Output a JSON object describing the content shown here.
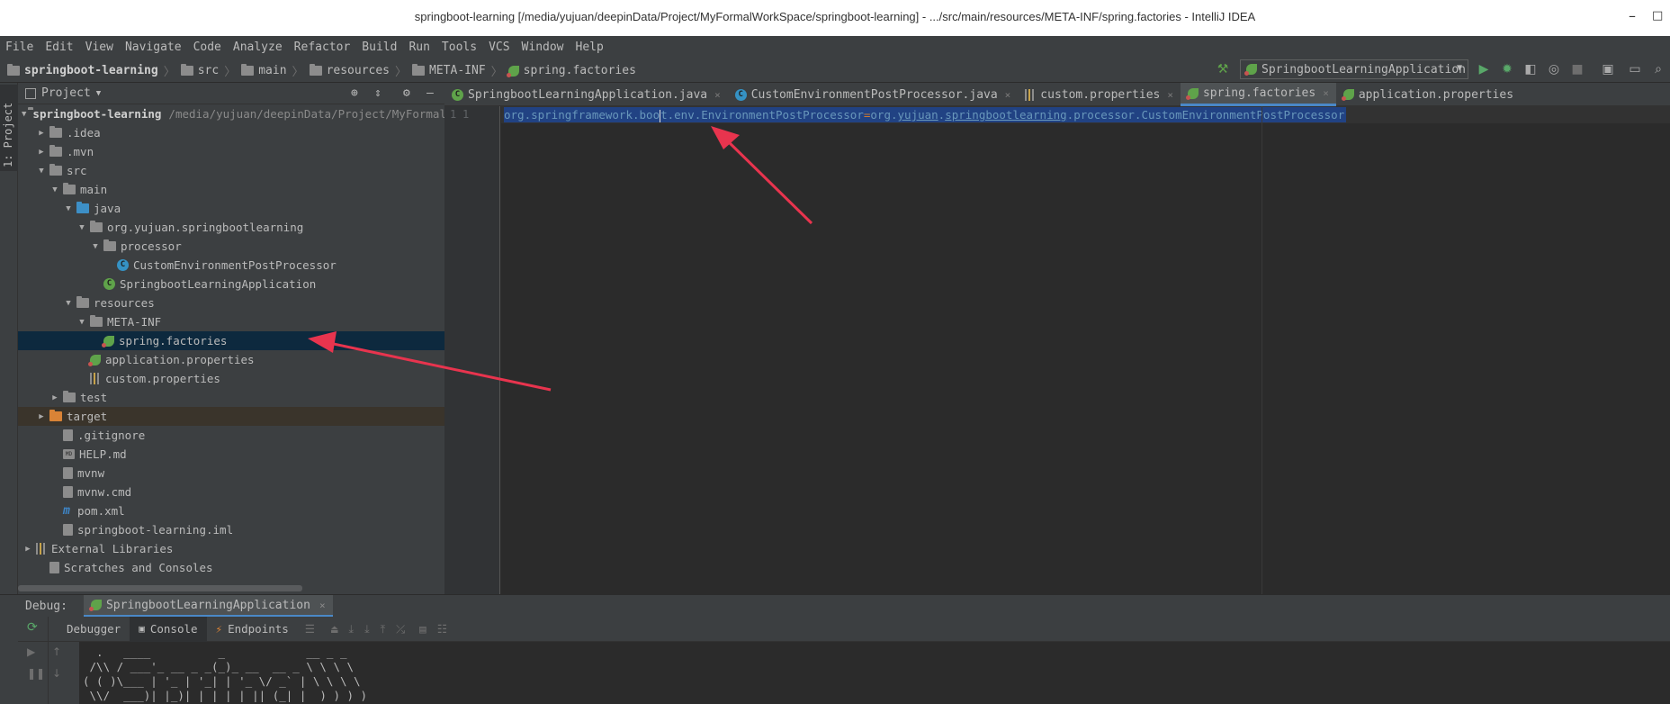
{
  "window": {
    "title": "springboot-learning [/media/yujuan/deepinData/Project/MyFormalWorkSpace/springboot-learning] - .../src/main/resources/META-INF/spring.factories - IntelliJ IDEA",
    "minimize": "–",
    "maximize": "□"
  },
  "menu": [
    "File",
    "Edit",
    "View",
    "Navigate",
    "Code",
    "Analyze",
    "Refactor",
    "Build",
    "Run",
    "Tools",
    "VCS",
    "Window",
    "Help"
  ],
  "breadcrumb": [
    "springboot-learning",
    "src",
    "main",
    "resources",
    "META-INF",
    "spring.factories"
  ],
  "run_config": {
    "label": "SpringbootLearningApplication"
  },
  "project_panel": {
    "title": "Project",
    "side_tab": "1: Project",
    "tree": [
      {
        "label": "springboot-learning",
        "path": "/media/yujuan/deepinData/Project/MyFormalW",
        "indent": 0,
        "arrow": "▼",
        "icon": "folder",
        "bold": true
      },
      {
        "label": ".idea",
        "indent": 1,
        "arrow": "▶",
        "icon": "folder"
      },
      {
        "label": ".mvn",
        "indent": 1,
        "arrow": "▶",
        "icon": "folder"
      },
      {
        "label": "src",
        "indent": 1,
        "arrow": "▼",
        "icon": "folder"
      },
      {
        "label": "main",
        "indent": 2,
        "arrow": "▼",
        "icon": "folder"
      },
      {
        "label": "java",
        "indent": 3,
        "arrow": "▼",
        "icon": "folder-blue"
      },
      {
        "label": "org.yujuan.springbootlearning",
        "indent": 4,
        "arrow": "▼",
        "icon": "folder"
      },
      {
        "label": "processor",
        "indent": 5,
        "arrow": "▼",
        "icon": "folder"
      },
      {
        "label": "CustomEnvironmentPostProcessor",
        "indent": 6,
        "arrow": "",
        "icon": "class"
      },
      {
        "label": "SpringbootLearningApplication",
        "indent": 5,
        "arrow": "",
        "icon": "spring-class"
      },
      {
        "label": "resources",
        "indent": 3,
        "arrow": "▼",
        "icon": "folder"
      },
      {
        "label": "META-INF",
        "indent": 4,
        "arrow": "▼",
        "icon": "folder"
      },
      {
        "label": "spring.factories",
        "indent": 5,
        "arrow": "",
        "icon": "leaf",
        "selected": true
      },
      {
        "label": "application.properties",
        "indent": 4,
        "arrow": "",
        "icon": "leaf"
      },
      {
        "label": "custom.properties",
        "indent": 4,
        "arrow": "",
        "icon": "prop"
      },
      {
        "label": "test",
        "indent": 2,
        "arrow": "▶",
        "icon": "folder"
      },
      {
        "label": "target",
        "indent": 1,
        "arrow": "▶",
        "icon": "folder-orange",
        "excluded": true
      },
      {
        "label": ".gitignore",
        "indent": 2,
        "arrow": "",
        "icon": "file"
      },
      {
        "label": "HELP.md",
        "indent": 2,
        "arrow": "",
        "icon": "md"
      },
      {
        "label": "mvnw",
        "indent": 2,
        "arrow": "",
        "icon": "file"
      },
      {
        "label": "mvnw.cmd",
        "indent": 2,
        "arrow": "",
        "icon": "file"
      },
      {
        "label": "pom.xml",
        "indent": 2,
        "arrow": "",
        "icon": "maven"
      },
      {
        "label": "springboot-learning.iml",
        "indent": 2,
        "arrow": "",
        "icon": "file"
      },
      {
        "label": "External Libraries",
        "indent": 0,
        "arrow": "▶",
        "icon": "libs"
      },
      {
        "label": "Scratches and Consoles",
        "indent": 1,
        "arrow": "",
        "icon": "scratch"
      }
    ]
  },
  "editor": {
    "tabs": [
      {
        "label": "SpringbootLearningApplication.java",
        "icon": "spring-class",
        "active": false,
        "close": "×"
      },
      {
        "label": "CustomEnvironmentPostProcessor.java",
        "icon": "class",
        "active": false,
        "close": "×"
      },
      {
        "label": "custom.properties",
        "icon": "prop",
        "active": false,
        "close": "×"
      },
      {
        "label": "spring.factories",
        "icon": "leaf",
        "active": true,
        "close": "×"
      },
      {
        "label": "application.properties",
        "icon": "leaf",
        "active": false,
        "close": ""
      }
    ],
    "gutter": {
      "line": "1",
      "fold": "1"
    },
    "line_key_before_caret": "org.springframework.boo",
    "line_key_after_caret": "t.env.EnvironmentPostProcessor",
    "line_eq": "=",
    "line_val_a": "org.",
    "line_val_b": "yujuan",
    "line_val_c": ".",
    "line_val_d": "springbootlearning",
    "line_val_e": ".processor.CustomEnvironmentPostProcessor"
  },
  "debug": {
    "label": "Debug:",
    "config": "SpringbootLearningApplication",
    "close": "×",
    "tabs": [
      "Debugger",
      "Console",
      "Endpoints"
    ],
    "console_lines": [
      "  .   ____          _            __ _ _",
      " /\\\\ / ___'_ __ _ _(_)_ __  __ _ \\ \\ \\ \\",
      "( ( )\\___ | '_ | '_| | '_ \\/ _` | \\ \\ \\ \\",
      " \\\\/  ___)| |_)| | | | | || (_| |  ) ) ) )"
    ]
  },
  "colors": {
    "annotation_arrow": "#e8344e",
    "selection": "#214283",
    "tab_underline": "#4a88c7"
  }
}
